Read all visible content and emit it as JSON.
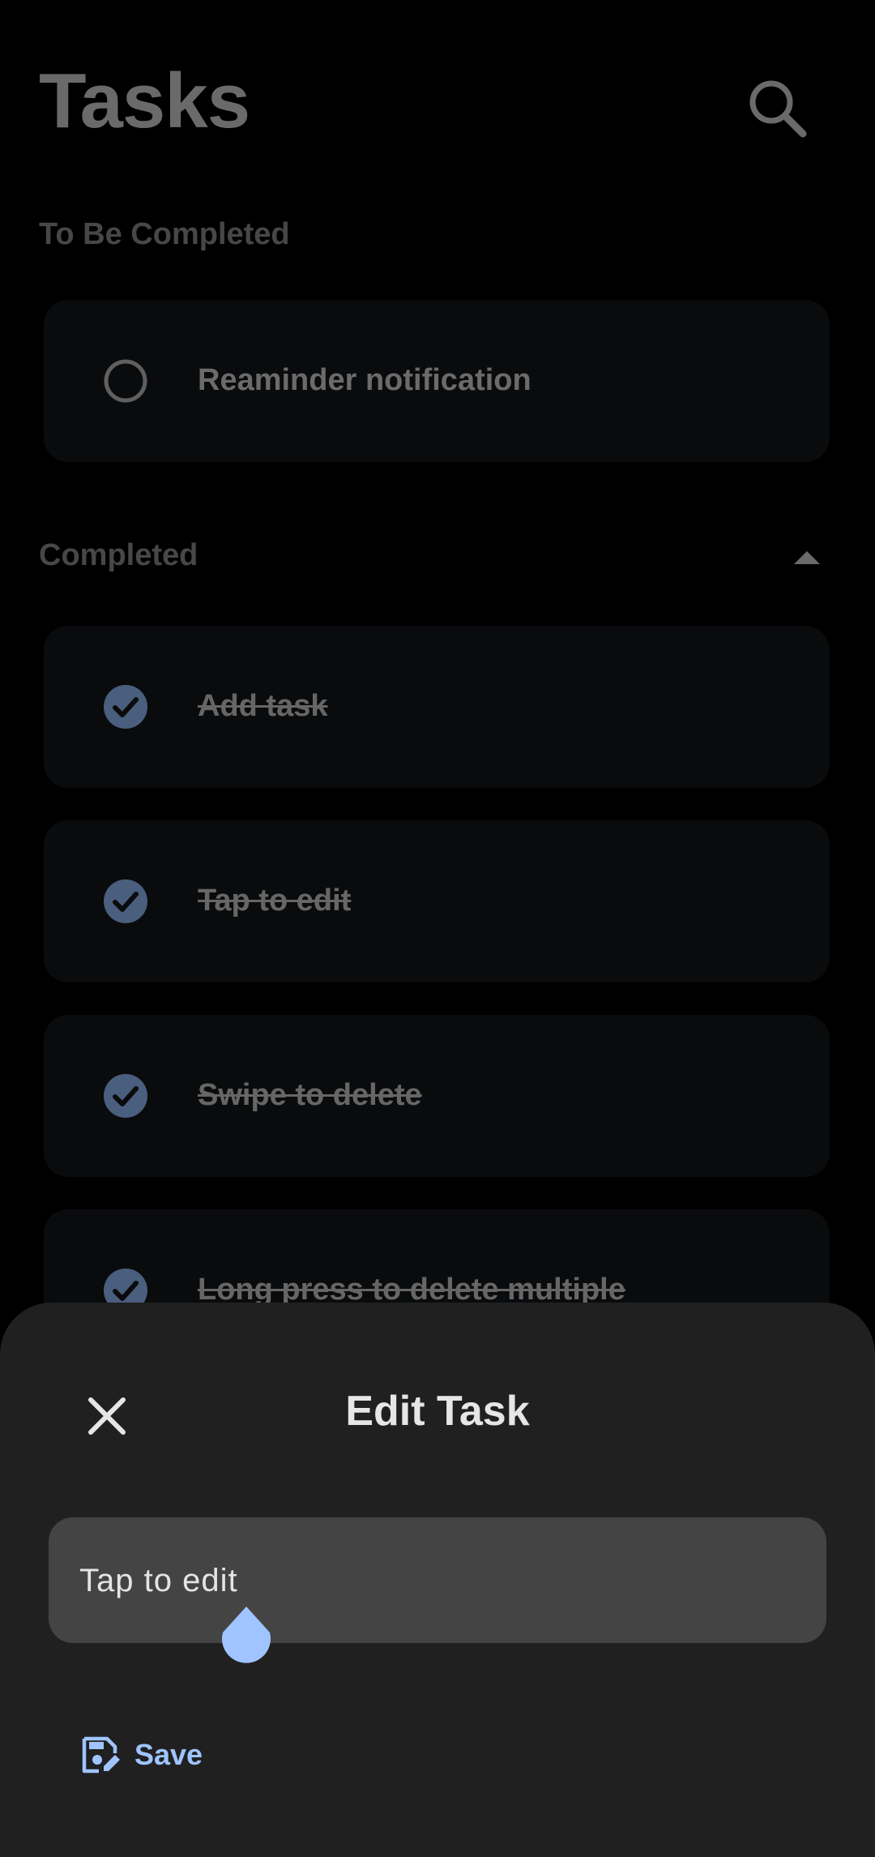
{
  "app": {
    "title": "Tasks"
  },
  "sections": {
    "pending_label": "To Be Completed",
    "completed_label": "Completed"
  },
  "pending_tasks": [
    {
      "label": "Reaminder notification",
      "done": false
    }
  ],
  "completed_tasks": [
    {
      "label": "Add task",
      "done": true
    },
    {
      "label": "Tap to edit",
      "done": true
    },
    {
      "label": "Swipe to delete",
      "done": true
    },
    {
      "label": "Long press to delete multiple",
      "done": true
    }
  ],
  "sheet": {
    "title": "Edit Task",
    "input_value": "Tap to edit",
    "save_label": "Save"
  },
  "icons": {
    "search": "search-icon",
    "collapse": "chevron-up-icon",
    "close": "close-icon",
    "save": "save-edit-icon",
    "checked": "check-circle-icon",
    "unchecked": "empty-circle-icon"
  },
  "colors": {
    "background": "#000000",
    "sheet": "#202020",
    "input": "#444444",
    "accent": "#9fc4ff",
    "check_fill": "#4a5e7d"
  }
}
